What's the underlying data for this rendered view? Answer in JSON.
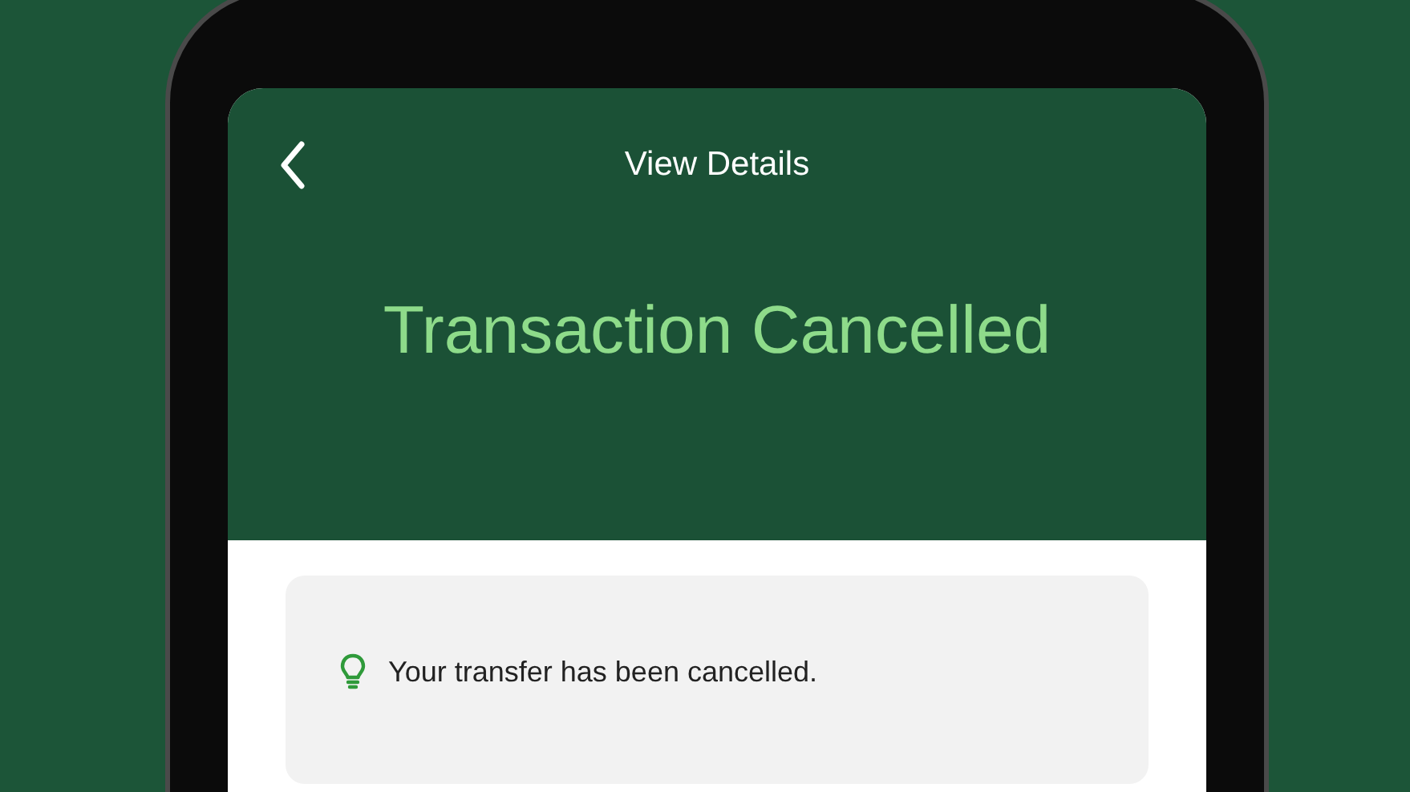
{
  "header": {
    "title": "View Details",
    "status_title": "Transaction Cancelled"
  },
  "notice": {
    "message": "Your transfer has been cancelled."
  }
}
